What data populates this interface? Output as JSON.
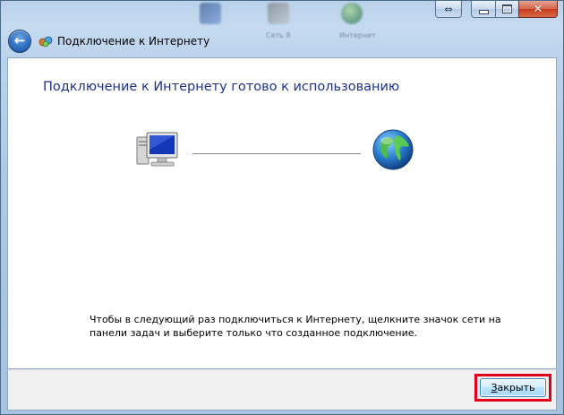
{
  "window": {
    "title": "Подключение к Интернету"
  },
  "background_labels": [
    "Сеть 8",
    "Интернет"
  ],
  "nav": {
    "title": "Подключение к Интернету"
  },
  "content": {
    "heading": "Подключение к Интернету готово к использованию",
    "hint": "Чтобы в следующий раз подключиться к Интернету, щелкните значок сети на панели задач и выберите только что созданное подключение."
  },
  "footer": {
    "close_label_first": "З",
    "close_label_rest": "акрыть"
  },
  "icons": {
    "back": "back-arrow-icon",
    "nav": "network-connection-icon",
    "computer": "computer-icon",
    "globe": "globe-icon"
  },
  "colors": {
    "heading": "#1e3287",
    "highlight": "#e0001b"
  }
}
